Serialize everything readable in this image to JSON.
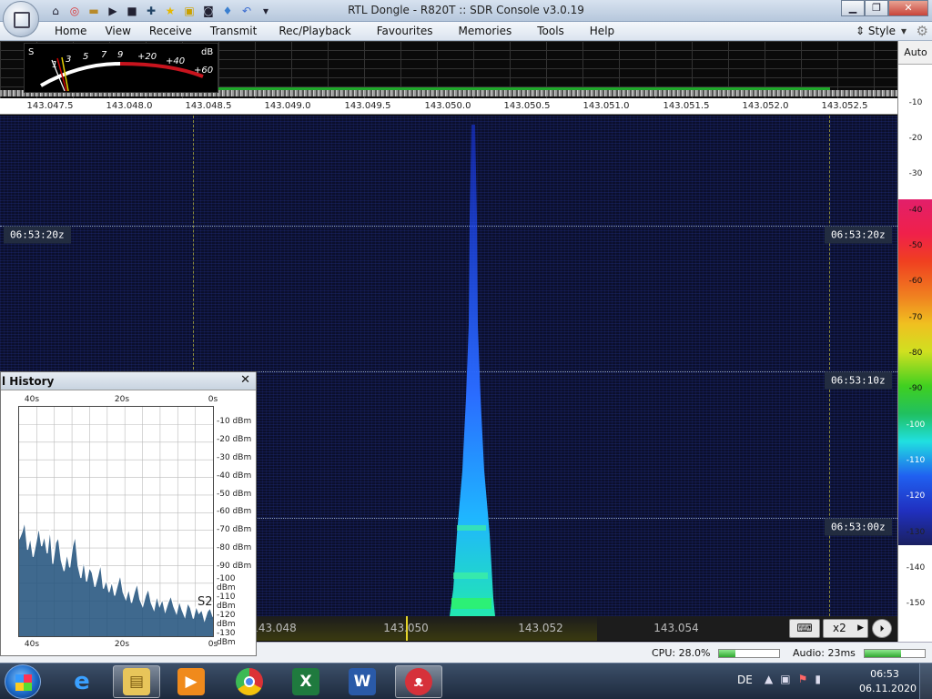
{
  "window": {
    "title": "RTL Dongle - R820T :: SDR Console v3.0.19"
  },
  "quick_access": [
    "home-icon",
    "lifebuoy-icon",
    "folder-icon",
    "play-icon",
    "stop-icon",
    "add-icon",
    "favourite-icon",
    "lock-icon",
    "camera-icon",
    "drop-icon",
    "undo-icon",
    "dropdown-icon"
  ],
  "menu": [
    "Home",
    "View",
    "Receive",
    "Transmit",
    "Rec/Playback",
    "Favourites",
    "Memories",
    "Tools",
    "Help"
  ],
  "style_menu": "Style",
  "smeter": {
    "s_scale": [
      "S",
      "1",
      "3",
      "5",
      "7",
      "9",
      "+20",
      "+40",
      "+60"
    ],
    "unit": "dB",
    "needle_level": "S1"
  },
  "freq_axis": [
    "143.047.5",
    "143.048.0",
    "143.048.5",
    "143.049.0",
    "143.049.5",
    "143.050.0",
    "143.050.5",
    "143.051.0",
    "143.051.5",
    "143.052.0",
    "143.052.5"
  ],
  "right_scale": {
    "auto_label": "Auto",
    "levels": [
      "-10",
      "-20",
      "-30",
      "-40",
      "-50",
      "-60",
      "-70",
      "-80",
      "-90",
      "-100",
      "-110",
      "-120",
      "-130",
      "-140",
      "-150"
    ]
  },
  "time_labels": [
    "06:53:20z",
    "06:53:10z",
    "06:53:00z"
  ],
  "bottom_band": {
    "freqs": [
      "143.048",
      "143.050",
      "143.052",
      "143.054"
    ],
    "zoom_label": "x2"
  },
  "signal_history": {
    "title": "l History",
    "top_axis": [
      "40s",
      "20s",
      "0s"
    ],
    "bottom_axis": [
      "40s",
      "20s",
      "0s"
    ],
    "db_labels": [
      "-10 dBm",
      "-20 dBm",
      "-30 dBm",
      "-40 dBm",
      "-50 dBm",
      "-60 dBm",
      "-70 dBm",
      "-80 dBm",
      "-90 dBm",
      "-100 dBm",
      "-110 dBm",
      "-120 dBm",
      "-130 dBm"
    ],
    "s_reading": "S2",
    "trace_dbm": [
      -80,
      -76,
      -70,
      -86,
      -79,
      -90,
      -82,
      -73,
      -84,
      -78,
      -88,
      -74,
      -94,
      -82,
      -79,
      -92,
      -98,
      -88,
      -96,
      -84,
      -78,
      -95,
      -102,
      -92,
      -104,
      -96,
      -99,
      -107,
      -101,
      -94,
      -108,
      -103,
      -110,
      -104,
      -112,
      -106,
      -100,
      -110,
      -114,
      -108,
      -116,
      -110,
      -105,
      -114,
      -118,
      -112,
      -108,
      -116,
      -120,
      -112,
      -118,
      -114,
      -121,
      -116,
      -112,
      -118,
      -122,
      -115,
      -120,
      -124,
      -116,
      -119,
      -125,
      -118,
      -122,
      -120,
      -126,
      -121,
      -119,
      -124
    ]
  },
  "status": {
    "cpu": "CPU: 28.0%",
    "cpu_fraction": 0.28,
    "audio": "Audio: 23ms",
    "audio_fraction": 0.6
  },
  "taskbar": {
    "apps": [
      "start-button",
      "internet-explorer-icon",
      "file-explorer-icon",
      "media-player-icon",
      "chrome-icon",
      "excel-icon",
      "word-icon",
      "sdr-console-icon"
    ],
    "lang": "DE",
    "time": "06:53",
    "date": "06.11.2020"
  }
}
